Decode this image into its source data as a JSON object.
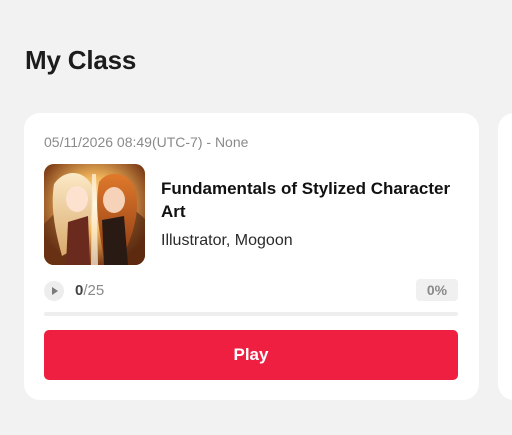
{
  "page": {
    "title": "My Class"
  },
  "class_card": {
    "timestamp": "05/11/2026 08:49(UTC-7) - None",
    "title": "Fundamentals of Stylized Character Art",
    "author": "Illustrator, Mogoon",
    "thumbnail": "anime-character-artwork",
    "lessons_done": "0",
    "lessons_total": "/25",
    "percent_label": "0%",
    "progress_fraction": 0,
    "play_label": "Play",
    "accent_color": "#ef1f42"
  }
}
